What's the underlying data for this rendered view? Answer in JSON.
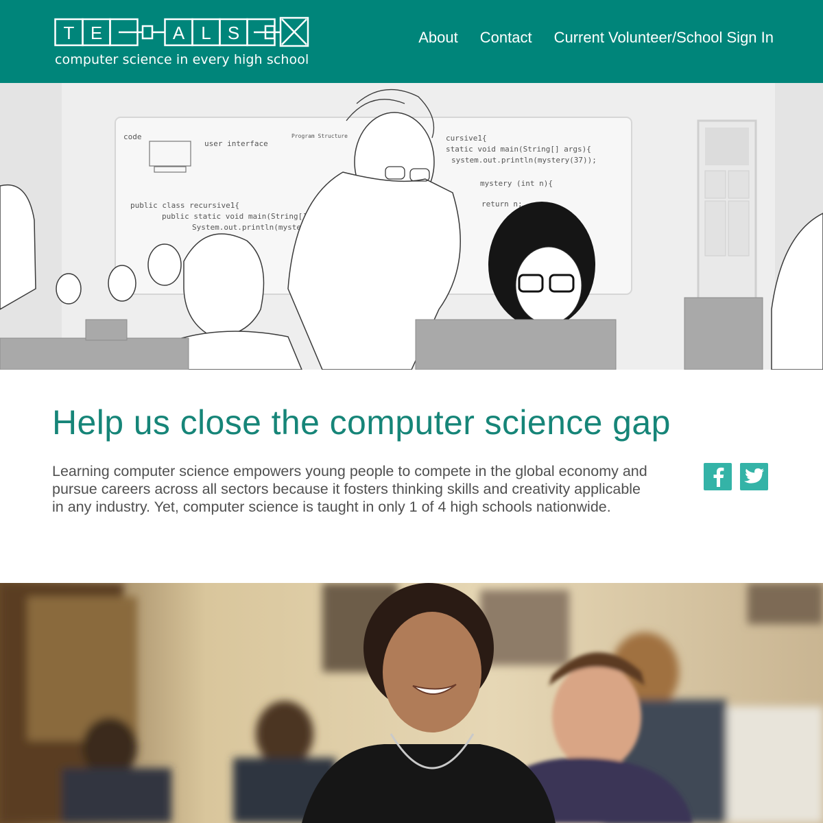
{
  "header": {
    "logo_letters": [
      "T",
      "E",
      "A",
      "L",
      "S"
    ],
    "logo_tagline": "computer science in every high school",
    "nav": [
      {
        "label": "About"
      },
      {
        "label": "Contact"
      },
      {
        "label": "Current Volunteer/School Sign In"
      }
    ]
  },
  "hero": {
    "whiteboard_code": [
      "cursive1{",
      "static void main(String[] args){",
      "system.out.println(mystery(37));",
      "mystery (int n){",
      "return n;",
      "public class recursive1{",
      "public static void main(String[] args){",
      "System.out.println(myste"
    ],
    "whiteboard_notes": [
      "code",
      "user interface",
      "Program Structure"
    ]
  },
  "intro": {
    "heading": "Help us close the computer science gap",
    "body": "Learning computer science empowers young people to compete in the global economy and pursue careers across all sectors because it fosters thinking skills and creativity applicable in any industry. Yet, computer science is taught in only 1 of 4 high schools nationwide.",
    "social": [
      {
        "icon": "facebook-icon"
      },
      {
        "icon": "twitter-icon"
      }
    ]
  },
  "colors": {
    "brand_teal": "#00857a",
    "heading_teal": "#168578",
    "social_teal": "#34b3a7",
    "body_text": "#505050"
  }
}
